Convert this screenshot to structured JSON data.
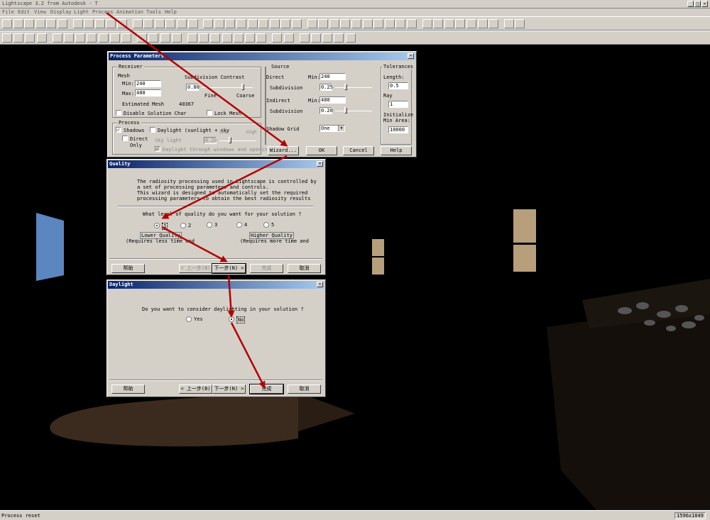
{
  "app": {
    "title": "Lightscape 3.2 from Autodesk - T"
  },
  "menu": [
    "File",
    "Edit",
    "View",
    "Display",
    "Light",
    "Process",
    "Animation",
    "Tools",
    "Help"
  ],
  "toolbar1": [
    "new",
    "open",
    "save",
    "undo",
    "print",
    "help",
    "query",
    "sel",
    "pick",
    "c1",
    "c2",
    "c3",
    "c4",
    "c5",
    "c6",
    "c7",
    "wire",
    "zoom",
    "zoomx",
    "zoomw",
    "pan",
    "orbit",
    "walk",
    "cam",
    "lamp",
    "dolly",
    "reset",
    "tilt",
    "fly",
    "rotate",
    "dot",
    "sphere",
    "circle",
    "cube",
    "run",
    "bulb",
    "solid",
    "layers",
    "copy",
    "paste",
    "stack",
    "sun",
    "glass",
    "globe",
    "cam2"
  ],
  "toolbar2": [
    "arrow",
    "select",
    "add",
    "sub",
    "vis",
    "hid",
    "trans",
    "scale",
    "rot",
    "mirror",
    "cut",
    "plus",
    "person",
    "orbit2",
    "rot2",
    "X",
    "Y",
    "Z",
    "XY",
    "YZ",
    "XZ",
    "AH",
    "r1",
    "r2",
    "m1",
    "m2",
    "m3",
    "m4",
    "m5"
  ],
  "status": {
    "message": "Process reset",
    "resolution": "1596x1049"
  },
  "process": {
    "title": "Process Parameters",
    "receiver": {
      "label": "Receiver",
      "mesh_label": "Mesh",
      "min_label": "Min:",
      "min": "240",
      "max_label": "Max:",
      "max": "480",
      "subdiv_label": "Subdivision Contrast",
      "subdiv": "0.80",
      "fine": "Fine",
      "coarse": "Coarse",
      "est_label": "Estimated Mesh",
      "est": "40367",
      "disable_label": "Disable Solution Char",
      "lock_label": "Lock Mesh"
    },
    "proc": {
      "label": "Process",
      "shadows": "Shadows",
      "daylight": "Daylight (sunlight + sky",
      "low": "Low",
      "high": "High",
      "direct_only": "Direct Only",
      "sky_light": "Sky light",
      "sky_val": "0.20",
      "through": "Daylight through windows and opening"
    },
    "source": {
      "label": "Source",
      "direct": "Direct",
      "d_min_label": "Min:",
      "d_min": "240",
      "d_subdiv": "Subdivision",
      "d_subdiv_val": "0.25",
      "indirect": "Indirect",
      "i_min_label": "Min:",
      "i_min": "480",
      "i_subdiv": "Subdivision",
      "i_subdiv_val": "0.20",
      "shadow_grid": "Shadow Grid",
      "shadow_grid_val": "One"
    },
    "tolerances": {
      "label": "Tolerances",
      "length_label": "Length:",
      "length": "0.5",
      "ray_label": "Ray",
      "ray": "1",
      "init_label": "Initialize Min Area:",
      "init": "10000"
    },
    "buttons": {
      "wizard": "Wizard...",
      "ok": "OK",
      "cancel": "Cancel",
      "help": "Help"
    }
  },
  "quality": {
    "title": "Quality",
    "intro": [
      "The radiosity processing used in Lightscape is controlled by",
      "a set of processing parameters and controls.",
      "This wizard is designed to automatically set the required",
      "processing parameters to obtain the best radiosity results"
    ],
    "question": "What level of quality do you want for your solution ?",
    "levels": [
      "1",
      "2",
      "3",
      "4",
      "5"
    ],
    "lower": "Lower Quality",
    "lower_note": "(Requires less time and",
    "higher": "Higher Quality",
    "higher_note": "(Requires more time and",
    "buttons": {
      "help": "帮助",
      "back": "< 上一步(B)",
      "next": "下一步(N) >",
      "finish": "完成",
      "cancel": "取消"
    }
  },
  "daylight": {
    "title": "Daylight",
    "question": "Do you want to consider daylighting in your solution ?",
    "yes": "Yes",
    "no": "No",
    "buttons": {
      "help": "帮助",
      "back": "< 上一步(B)",
      "next": "下一步(N) >",
      "finish": "完成",
      "cancel": "取消"
    }
  }
}
